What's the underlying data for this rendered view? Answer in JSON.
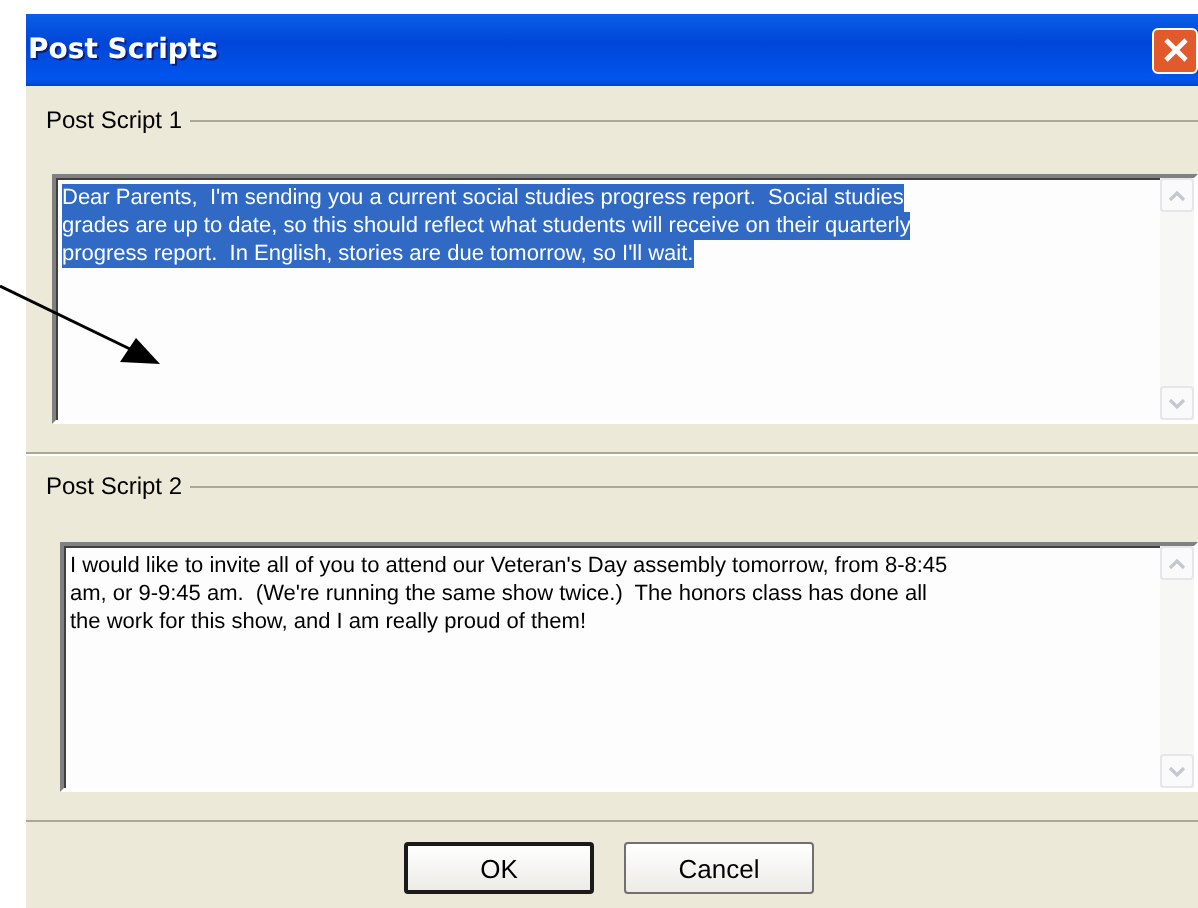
{
  "window": {
    "title": "Post Scripts"
  },
  "post_scripts": [
    {
      "label": "Post Script 1",
      "lines": [
        "Dear Parents,  I'm sending you a current social studies progress report.  Social studies",
        "grades are up to date, so this should reflect what students will receive on their quarterly",
        "progress report.  In English, stories are due tomorrow, so I'll wait."
      ],
      "selected": true
    },
    {
      "label": "Post Script 2",
      "lines": [
        "I would like to invite all of you to attend our Veteran's Day assembly tomorrow, from 8-8:45",
        "am, or 9-9:45 am.  (We're running the same show twice.)  The honors class has done all",
        "the work for this show, and I am really proud of them!"
      ],
      "selected": false
    }
  ],
  "buttons": [
    {
      "label": "OK",
      "kind": "default"
    },
    {
      "label": "Cancel",
      "kind": "normal"
    }
  ]
}
